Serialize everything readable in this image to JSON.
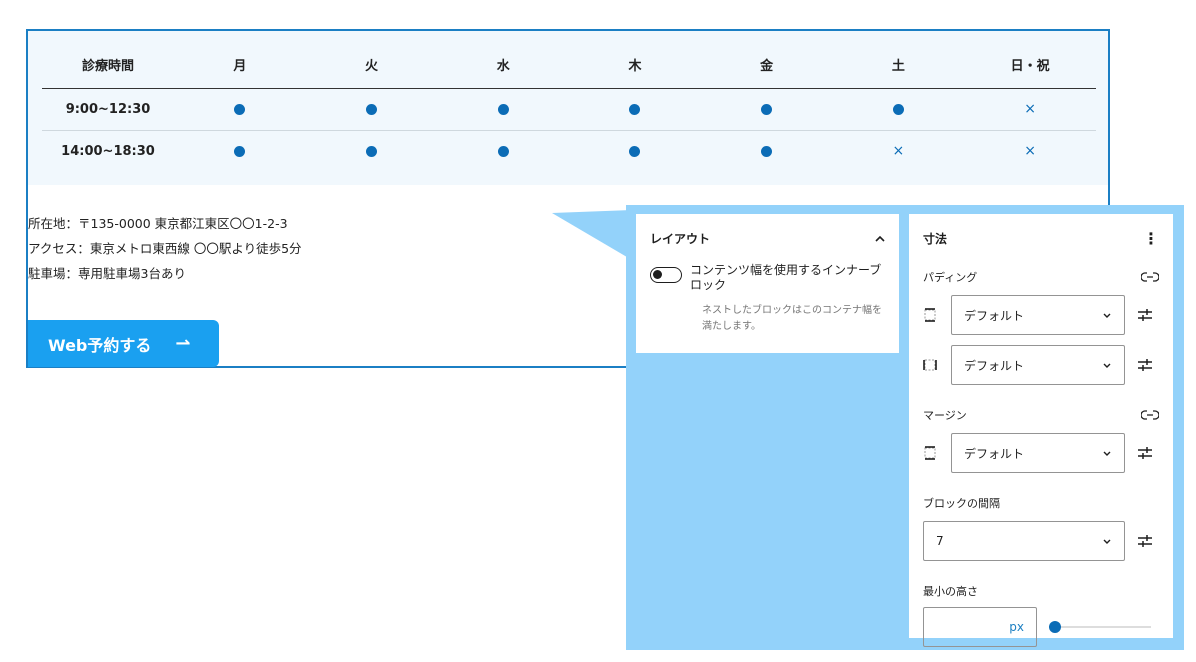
{
  "hours_table": {
    "headers": [
      "診療時間",
      "月",
      "火",
      "水",
      "木",
      "金",
      "土",
      "日・祝"
    ],
    "rows": [
      {
        "time": "9:00~12:30",
        "cells": [
          "●",
          "●",
          "●",
          "●",
          "●",
          "●",
          "×"
        ]
      },
      {
        "time": "14:00~18:30",
        "cells": [
          "●",
          "●",
          "●",
          "●",
          "●",
          "×",
          "×"
        ]
      }
    ]
  },
  "info": {
    "address": "所在地：〒135-0000 東京都江東区〇〇1-2-3",
    "access": "アクセス：東京メトロ東西線 〇〇駅より徒歩5分",
    "parking": "駐車場：専用駐車場3台あり"
  },
  "web_button": {
    "label": "Web予約する",
    "arrow": "⇀"
  },
  "layout_panel": {
    "title": "レイアウト",
    "toggle_label": "コンテンツ幅を使用するインナーブロック",
    "toggle_on": false,
    "help_text": "ネストしたブロックはこのコンテナ幅を満たします。"
  },
  "dimensions_panel": {
    "title": "寸法",
    "padding_label": "パディング",
    "padding_vertical_value": "デフォルト",
    "padding_horizontal_value": "デフォルト",
    "margin_label": "マージン",
    "margin_vertical_value": "デフォルト",
    "block_gap_label": "ブロックの間隔",
    "block_gap_value": "7",
    "min_height_label": "最小の高さ",
    "min_height_unit": "px",
    "min_height_slider_fraction": 0
  },
  "colors": {
    "accent_blue": "#0b6cb6",
    "button_blue": "#1aa0f0",
    "callout_bg": "#93d2fa",
    "table_bg": "#f1f8fd"
  },
  "icons": {
    "dot": "filled-circle-icon",
    "cross": "cross-icon",
    "link": "link-icon",
    "tune": "sliders-icon",
    "more": "kebab-menu-icon"
  }
}
